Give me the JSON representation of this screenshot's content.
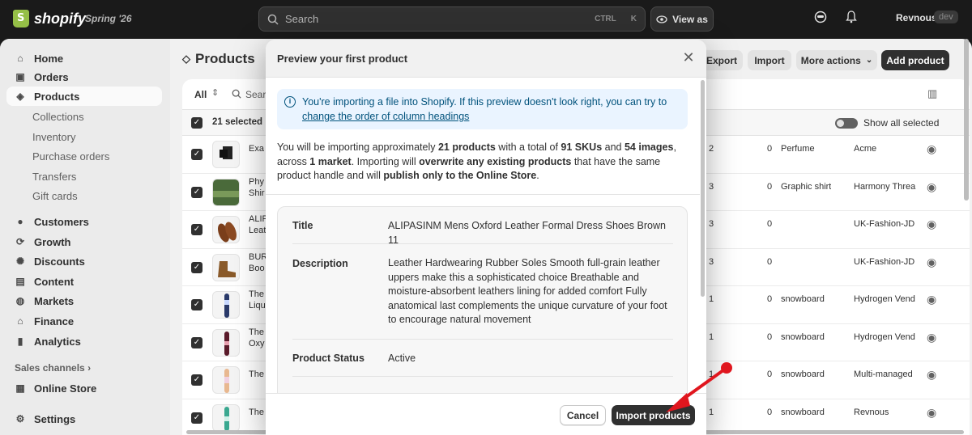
{
  "topbar": {
    "brand": "shopify",
    "edition": "Spring '26",
    "search_placeholder": "Search",
    "shortcut_ctrl": "CTRL",
    "shortcut_k": "K",
    "view_as": "View as",
    "store_name": "Revnous",
    "store_badge": "dev"
  },
  "sidebar": {
    "items": [
      {
        "label": "Home",
        "icon": "home-icon"
      },
      {
        "label": "Orders",
        "icon": "orders-icon"
      },
      {
        "label": "Products",
        "icon": "tag-icon",
        "active": true
      }
    ],
    "product_subitems": [
      "Collections",
      "Inventory",
      "Purchase orders",
      "Transfers",
      "Gift cards"
    ],
    "items2": [
      {
        "label": "Customers",
        "icon": "person-icon"
      },
      {
        "label": "Growth",
        "icon": "growth-icon"
      },
      {
        "label": "Discounts",
        "icon": "discount-icon"
      },
      {
        "label": "Content",
        "icon": "content-icon"
      },
      {
        "label": "Markets",
        "icon": "globe-icon"
      },
      {
        "label": "Finance",
        "icon": "bank-icon"
      },
      {
        "label": "Analytics",
        "icon": "chart-icon"
      }
    ],
    "sales_channels_label": "Sales channels",
    "online_store": "Online Store",
    "settings": "Settings"
  },
  "page": {
    "title": "Products",
    "export": "Export",
    "import": "Import",
    "more_actions": "More actions",
    "add_product": "Add product",
    "tab_all": "All",
    "search_partial": "Sear",
    "selected_count": "21 selected",
    "show_all_selected": "Show all selected"
  },
  "table": {
    "rows": [
      {
        "name1": "Exa",
        "name2": "",
        "num": "2",
        "inv": "0",
        "type": "Perfume",
        "vendor": "Acme"
      },
      {
        "name1": "Phy",
        "name2": "Shir",
        "num": "3",
        "inv": "0",
        "type": "Graphic shirt",
        "vendor": "Harmony Threa"
      },
      {
        "name1": "ALIP",
        "name2": "Leat",
        "num": "3",
        "inv": "0",
        "type": "",
        "vendor": "UK-Fashion-JD"
      },
      {
        "name1": "BUR",
        "name2": "Boo",
        "num": "3",
        "inv": "0",
        "type": "",
        "vendor": "UK-Fashion-JD"
      },
      {
        "name1": "The",
        "name2": "Liqu",
        "num": "1",
        "inv": "0",
        "type": "snowboard",
        "vendor": "Hydrogen Vend"
      },
      {
        "name1": "The",
        "name2": "Oxy",
        "num": "1",
        "inv": "0",
        "type": "snowboard",
        "vendor": "Hydrogen Vend"
      },
      {
        "name1": "The",
        "name2": "",
        "num": "1",
        "inv": "0",
        "type": "snowboard",
        "vendor": "Multi-managed"
      },
      {
        "name1": "The",
        "name2": "",
        "num": "1",
        "inv": "0",
        "type": "snowboard",
        "vendor": "Revnous"
      }
    ]
  },
  "modal": {
    "title": "Preview your first product",
    "banner_text": "You're importing a file into Shopify. If this preview doesn't look right, you can try to",
    "banner_link": "change the order of column headings",
    "summary": {
      "s1": "You will be importing approximately ",
      "products": "21 products",
      "s2": " with a total of ",
      "skus": "91 SKUs",
      "s3": " and ",
      "images": "54 images",
      "s4": ", across ",
      "market": "1 market",
      "s5": ". Importing will ",
      "overwrite": "overwrite any existing products",
      "s6": " that have the same product handle and will ",
      "publish": "publish only to the Online Store",
      "s7": "."
    },
    "preview": {
      "title_label": "Title",
      "title_value": "ALIPASINM Mens Oxford Leather Formal Dress Shoes Brown 11",
      "description_label": "Description",
      "description_value": "Leather Hardwearing Rubber Soles Smooth full-grain leather uppers make this a sophisticated choice Breathable and moisture-absorbent leathers lining for added comfort Fully anatomical last complements the unique curvature of your foot to encourage natural movement",
      "status_label": "Product Status",
      "status_value": "Active"
    },
    "cancel": "Cancel",
    "import_products": "Import products"
  },
  "colors": {
    "accent_arrow": "#e0161e",
    "primary_button": "#303030",
    "banner_bg": "#eaf4ff"
  }
}
